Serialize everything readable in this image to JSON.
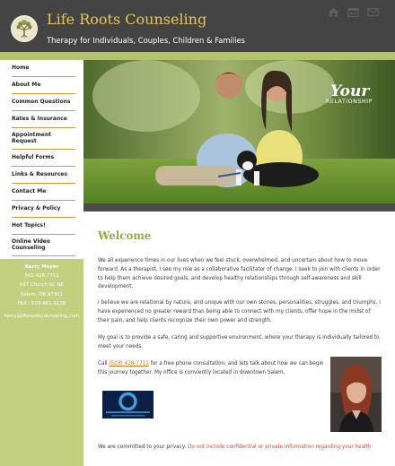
{
  "header": {
    "title": "Life Roots Counseling",
    "tagline": "Therapy for Individuals, Couples, Children & Families",
    "icons": [
      "home-icon",
      "calendar-icon",
      "mail-icon"
    ],
    "colors": {
      "bar": "#444444",
      "title": "#e6c64e",
      "band": "#b3c270"
    }
  },
  "sidebar": {
    "nav": [
      {
        "label": "Home"
      },
      {
        "label": "About Me"
      },
      {
        "label": "Common Questions"
      },
      {
        "label": "Rates & Insurance"
      },
      {
        "label": "Appointment Request",
        "lines": [
          "Appointment",
          "Request"
        ]
      },
      {
        "label": "Helpful Forms"
      },
      {
        "label": "Links & Resources"
      },
      {
        "label": "Contact Me"
      },
      {
        "label": "Privacy & Policy"
      },
      {
        "label": "Hot Topics!"
      },
      {
        "label": "Online Video Counseling",
        "lines": [
          "Online Video",
          "Counseling"
        ]
      }
    ],
    "contact": {
      "name": "Kerry Moyer",
      "phone": "503-428-7711",
      "street": "687 Church St. NE",
      "city": "Salem, OR 97301",
      "fax": "FAX : 503-961-9138",
      "email": "kerry@liferootscounseling.com"
    }
  },
  "hero": {
    "overlay_title": "Your",
    "overlay_subtitle": "RELATIONSHIP"
  },
  "main": {
    "heading": "Welcome",
    "p1": "We all experience times in our lives when we feel stuck, overwhelmed, and uncertain about how to move forward. As a therapist, I see my role as a collaborative facilitator of change. I seek to join with clients in order to help them achieve desired goals, and develop healthy relationships through self-awareness and skill development.",
    "p2": "I believe we are relational by nature, and unique with our own stories, personalities, struggles, and triumphs. I have experienced no greater reward than being able to connect with my clients, offer hope in the midst of their pain, and help clients recognize their own power and strength.",
    "p3": "My goal is to provide a safe, caring and supportive environment, where your therapy is individually tailored to meet your needs.",
    "p4_before": "Call ",
    "p4_phone": "(503) 428-7711",
    "p4_after": " for a free phone consultation, and lets talk about how we can begin this journey together. My office is conviently located in downtown Salem.",
    "p5_before": "We are committed to your privacy. ",
    "p5_warning": "Do not include confidential or private information regarding your health"
  },
  "colors": {
    "accent_green": "#9aa84a",
    "nav_underline": "#d39a3a",
    "sidebar_contact_bg": "#c2cf7f",
    "link": "#c67a25",
    "warning": "#d24a34"
  }
}
